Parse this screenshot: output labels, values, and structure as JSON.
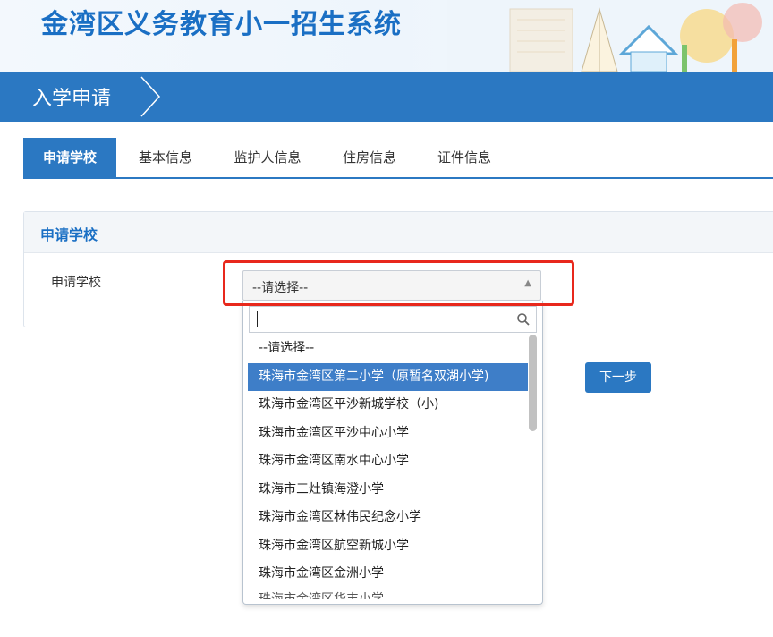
{
  "header": {
    "title": "金湾区义务教育小一招生系统"
  },
  "nav": {
    "title": "入学申请"
  },
  "tabs": [
    {
      "label": "申请学校",
      "active": true
    },
    {
      "label": "基本信息",
      "active": false
    },
    {
      "label": "监护人信息",
      "active": false
    },
    {
      "label": "住房信息",
      "active": false
    },
    {
      "label": "证件信息",
      "active": false
    }
  ],
  "panel": {
    "title": "申请学校",
    "field_label": "申请学校"
  },
  "select": {
    "value": "--请选择--",
    "search_value": "",
    "options": [
      "--请选择--",
      "珠海市金湾区第二小学（原暂名双湖小学)",
      "珠海市金湾区平沙新城学校（小)",
      "珠海市金湾区平沙中心小学",
      "珠海市金湾区南水中心小学",
      "珠海市三灶镇海澄小学",
      "珠海市金湾区林伟民纪念小学",
      "珠海市金湾区航空新城小学",
      "珠海市金湾区金洲小学",
      "珠海市金湾区华丰小学"
    ],
    "selected_index": 1
  },
  "buttons": {
    "next": "下一步"
  },
  "colors": {
    "primary": "#2b78c2",
    "title": "#1a6fc4",
    "highlight_frame": "#e8281c",
    "selected_option": "#3e7ec8"
  },
  "icons": {
    "search": "search-icon",
    "select_arrow": "caret-up-icon",
    "nav_chevron": "chevron-right-icon"
  }
}
